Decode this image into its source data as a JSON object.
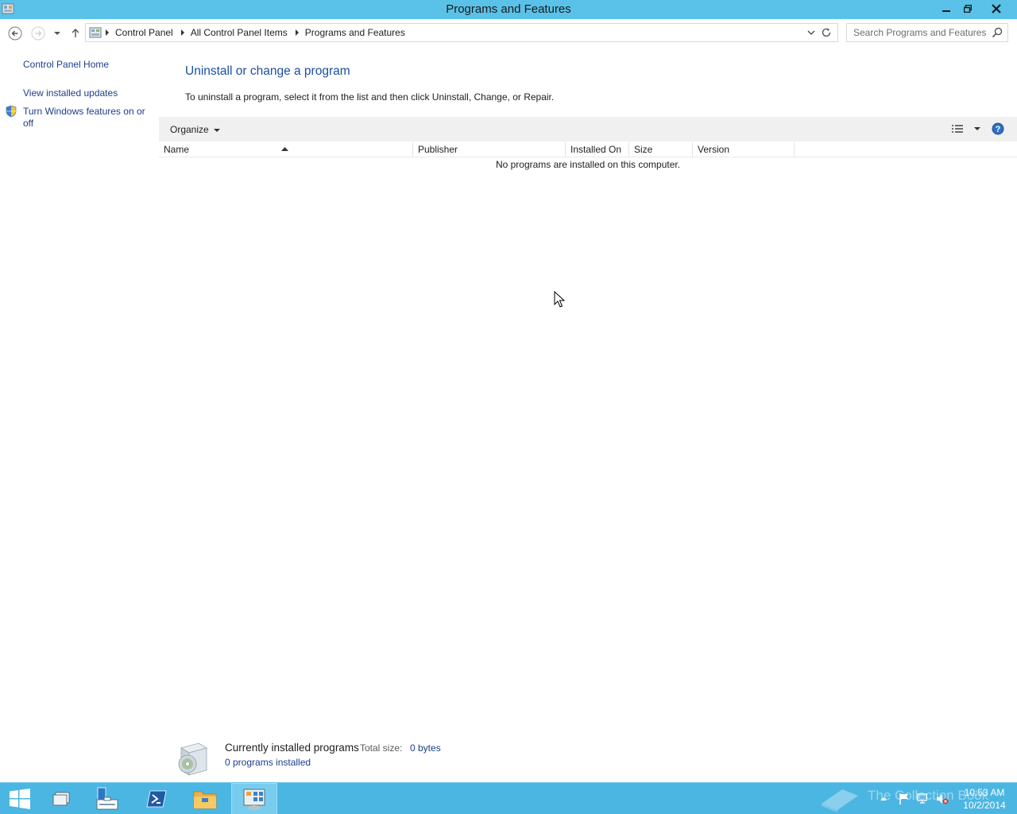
{
  "window": {
    "title": "Programs and Features"
  },
  "address_bar": {
    "breadcrumbs": [
      "Control Panel",
      "All Control Panel Items",
      "Programs and Features"
    ]
  },
  "search": {
    "placeholder": "Search Programs and Features"
  },
  "left_pane": {
    "home_link": "Control Panel Home",
    "updates_link": "View installed updates",
    "features_link": "Turn Windows features on or off"
  },
  "main": {
    "heading": "Uninstall or change a program",
    "instructions": "To uninstall a program, select it from the list and then click Uninstall, Change, or Repair.",
    "organize_label": "Organize",
    "columns": {
      "name": "Name",
      "publisher": "Publisher",
      "installed_on": "Installed On",
      "size": "Size",
      "version": "Version"
    },
    "empty_message": "No programs are installed on this computer."
  },
  "details": {
    "title": "Currently installed programs",
    "total_size_label": "Total size:",
    "total_size_value": "0 bytes",
    "count": "0 programs installed"
  },
  "taskbar": {
    "time": "10:53 AM",
    "date": "10/2/2014",
    "watermark": "The Collection Book"
  },
  "colors": {
    "titlebar": "#5ac2e8",
    "taskbar": "#4cb6e2",
    "link": "#1c3e8c",
    "heading": "#1b4fa0"
  }
}
